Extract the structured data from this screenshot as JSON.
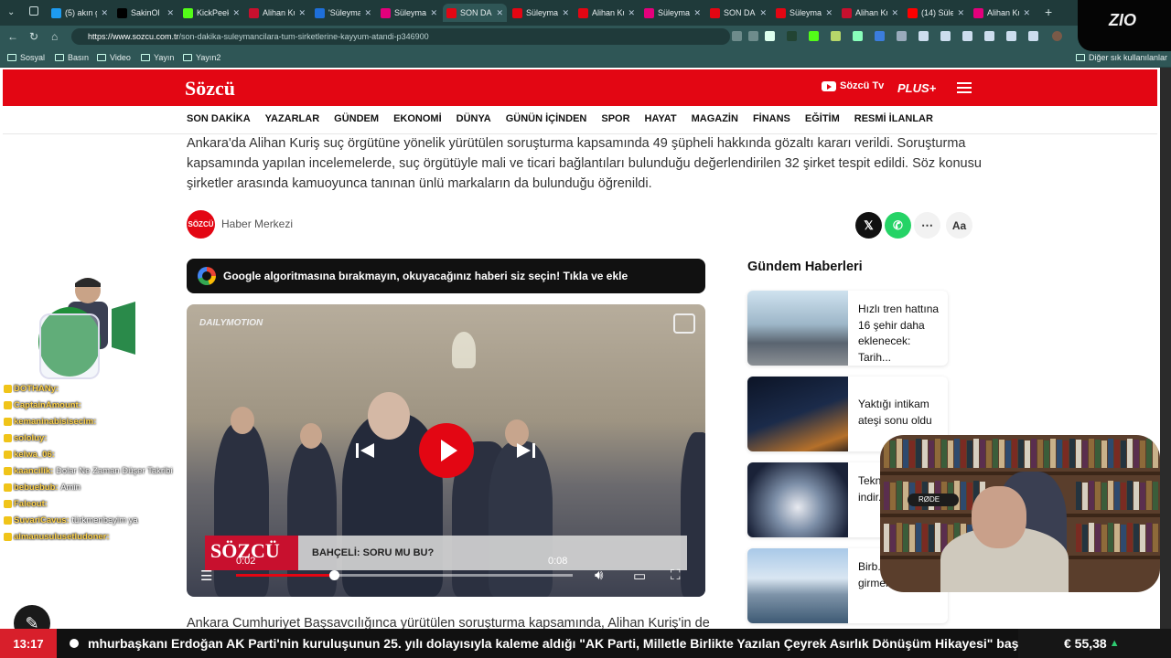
{
  "browser": {
    "tabs": [
      {
        "label": "(5) akın g",
        "color": "#1d9bf0"
      },
      {
        "label": "SakinOl",
        "color": "#000000"
      },
      {
        "label": "KickPeek",
        "color": "#53fc18"
      },
      {
        "label": "Alihan Ku",
        "color": "#c8102e"
      },
      {
        "label": "'Süleyma",
        "color": "#1e6fd9"
      },
      {
        "label": "Süleyman",
        "color": "#e4007c"
      },
      {
        "label": "SON DAK",
        "color": "#e30613"
      },
      {
        "label": "Süleyman",
        "color": "#e30613"
      },
      {
        "label": "Alihan Ku",
        "color": "#e30613"
      },
      {
        "label": "Süleyman",
        "color": "#e4007c"
      },
      {
        "label": "SON DAK",
        "color": "#e30613"
      },
      {
        "label": "Süleyman",
        "color": "#e30613"
      },
      {
        "label": "Alihan Ku",
        "color": "#c8102e"
      },
      {
        "label": "(14) Süley",
        "color": "#ff0000"
      },
      {
        "label": "Alihan Ku",
        "color": "#e4007c"
      }
    ],
    "url_host": "https://www.sozcu.com.tr",
    "url_path": "/son-dakika-suleymancilara-tum-sirketlerine-kayyum-atandi-p346900",
    "bookmarks": [
      "Sosyal",
      "Basın",
      "Video",
      "Yayın",
      "Yayın2"
    ],
    "other_bookmarks": "Diğer sık kullanılanlar"
  },
  "site": {
    "logo": "Sözcü",
    "tv": "Sözcü Tv",
    "plus": "PLUS+",
    "nav": [
      "SON DAKİKA",
      "YAZARLAR",
      "GÜNDEM",
      "EKONOMİ",
      "DÜNYA",
      "GÜNÜN İÇİNDEN",
      "SPOR",
      "HAYAT",
      "MAGAZİN",
      "FİNANS",
      "EĞİTİM",
      "RESMİ İLANLAR"
    ]
  },
  "article": {
    "summary": "Ankara'da Alihan Kuriş suç örgütüne yönelik yürütülen soruşturma kapsamında 49 şüpheli hakkında gözaltı kararı verildi. Soruşturma kapsamında yapılan incelemelerde, suç örgütüyle mali ve ticari bağlantıları bulunduğu değerlendirilen 32 şirket tespit edildi. Söz konusu şirketler arasında kamuoyunca tanınan ünlü markaların da bulunduğu öğrenildi.",
    "author_logo": "SÖZCÜ",
    "author": "Haber Merkezi",
    "share_text_size": "Aa",
    "google_banner": "Google algoritmasına bırakmayın, okuyacağınız haberi siz seçin! Tıkla ve ekle",
    "body_start": "Ankara Cumhuriyet Başsavcılığınca yürütülen soruşturma kapsamında, Alihan Kuriş'in de"
  },
  "video": {
    "provider": "DAILYMOTION",
    "lower_third_logo": "SÖZCÜ",
    "lower_third_title": "BAHÇELİ: SORU MU BU?",
    "time_current": "0:02",
    "time_total": "0:08",
    "progress": 0.29
  },
  "sidebar": {
    "title": "Gündem Haberleri",
    "cards": [
      {
        "title": "Hızlı tren hattına 16 şehir daha eklenecek: Tarih..."
      },
      {
        "title": "Yaktığı intikam ateşi sonu oldu"
      },
      {
        "title": "Tekn... mağ... indir..."
      },
      {
        "title": "Birb... iki şeh... girmek 3 gün..."
      }
    ]
  },
  "overlay": {
    "brand": "ZIO",
    "clock": "13:17",
    "ticker": "mhurbaşkanı Erdoğan AK Parti'nin kuruluşunun 25. yılı dolayısıyla kaleme aldığı \"AK Parti, Milletle Birlikte Yazılan Çeyrek Asırlık Dönüşüm Hikayesi\" başlıklı m",
    "euro": "€ 55,38",
    "euro_trend": "▲",
    "chat": [
      {
        "name": "DOTHANy:",
        "msg": ""
      },
      {
        "name": "CaptainAmount:",
        "msg": ""
      },
      {
        "name": "kemaninabisisecim:",
        "msg": ""
      },
      {
        "name": "sololuy:",
        "msg": ""
      },
      {
        "name": "kelwa_06:",
        "msg": ""
      },
      {
        "name": "kaancilik:",
        "msg": "Dolar Ne Zaman Düşer Takribi"
      },
      {
        "name": "bebuebub:",
        "msg": "Amin"
      },
      {
        "name": "Faleout:",
        "msg": ""
      },
      {
        "name": "SuvariCavus:",
        "msg": "türkmenbeyim ya"
      },
      {
        "name": "almanusulusetludoner:",
        "msg": ""
      }
    ]
  }
}
